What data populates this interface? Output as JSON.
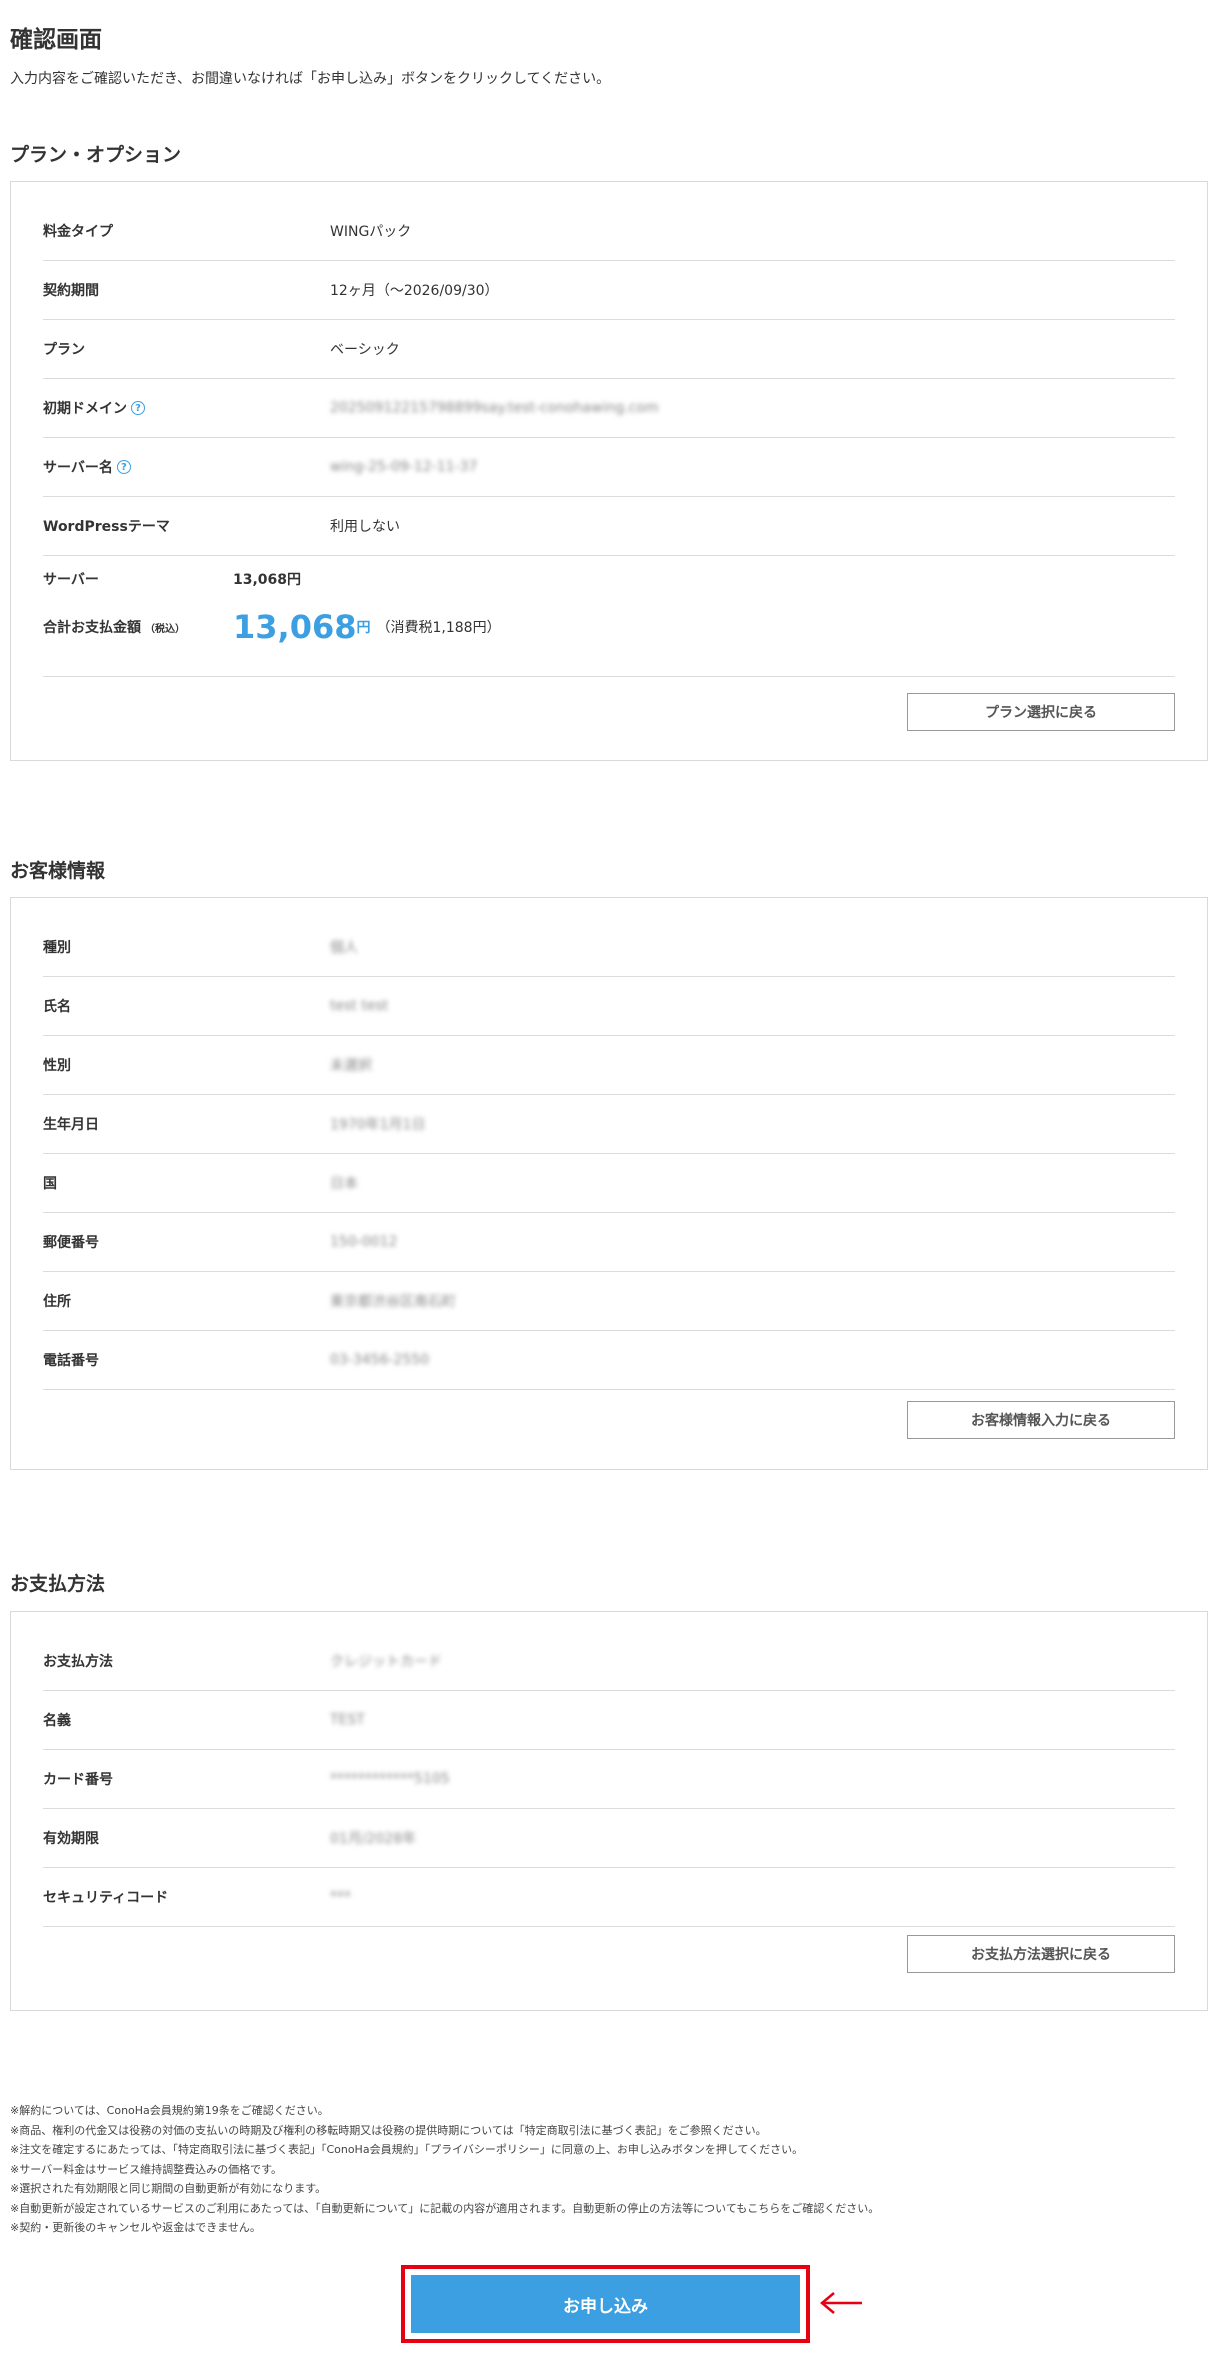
{
  "page": {
    "title": "確認画面",
    "description": "入力内容をご確認いただき、お間違いなければ「お申し込み」ボタンをクリックしてください。"
  },
  "plan_section": {
    "title": "プラン・オプション",
    "rows": [
      {
        "label": "料金タイプ",
        "value": "WINGパック"
      },
      {
        "label": "契約期間",
        "value": "12ヶ月（〜2026/09/30）"
      },
      {
        "label": "プラン",
        "value": "ベーシック"
      },
      {
        "label": "初期ドメイン",
        "value": "20250912215798899say.test-conohawing.com"
      },
      {
        "label": "サーバー名",
        "value": "wing-25-09-12-11-37"
      },
      {
        "label": "WordPressテーマ",
        "value": "利用しない"
      }
    ],
    "server_label": "サーバー",
    "server_price": "13,068円",
    "total_label": "合計お支払金額",
    "total_tax_note": "（税込）",
    "total_amount": "13,068",
    "total_unit": "円",
    "total_tax": "（消費税1,188円）",
    "back_button": "プラン選択に戻る"
  },
  "customer_section": {
    "title": "お客様情報",
    "rows": [
      {
        "label": "種別",
        "value": "個人"
      },
      {
        "label": "氏名",
        "value": "test test"
      },
      {
        "label": "性別",
        "value": "未選択"
      },
      {
        "label": "生年月日",
        "value": "1970年1月1日"
      },
      {
        "label": "国",
        "value": "日本"
      },
      {
        "label": "郵便番号",
        "value": "150-0012"
      },
      {
        "label": "住所",
        "value": "東京都渋谷区南石町"
      },
      {
        "label": "電話番号",
        "value": "03-3456-2550"
      }
    ],
    "back_button": "お客様情報入力に戻る"
  },
  "payment_section": {
    "title": "お支払方法",
    "rows": [
      {
        "label": "お支払方法",
        "value": "クレジットカード"
      },
      {
        "label": "名義",
        "value": "TEST"
      },
      {
        "label": "カード番号",
        "value": "************5105"
      },
      {
        "label": "有効期限",
        "value": "01月/2028年"
      },
      {
        "label": "セキュリティコード",
        "value": "***"
      }
    ],
    "back_button": "お支払方法選択に戻る"
  },
  "notes": [
    "※解約については、ConoHa会員規約第19条をご確認ください。",
    "※商品、権利の代金又は役務の対価の支払いの時期及び権利の移転時期又は役務の提供時期については「特定商取引法に基づく表記」をご参照ください。",
    "※注文を確定するにあたっては、「特定商取引法に基づく表記」「ConoHa会員規約」「プライバシーポリシー」に同意の上、お申し込みボタンを押してください。",
    "※サーバー料金はサービス維持調整費込みの価格です。",
    "※選択された有効期限と同じ期間の自動更新が有効になります。",
    "※自動更新が設定されているサービスのご利用にあたっては、「自動更新について」に記載の内容が適用されます。自動更新の停止の方法等についてもこちらをご確認ください。",
    "※契約・更新後のキャンセルや返金はできません。"
  ],
  "submit_button": "お申し込み",
  "colors": {
    "accent": "#3b9fe2",
    "highlight_frame": "#e60012",
    "text": "#333333",
    "border": "#d9d9d9"
  }
}
